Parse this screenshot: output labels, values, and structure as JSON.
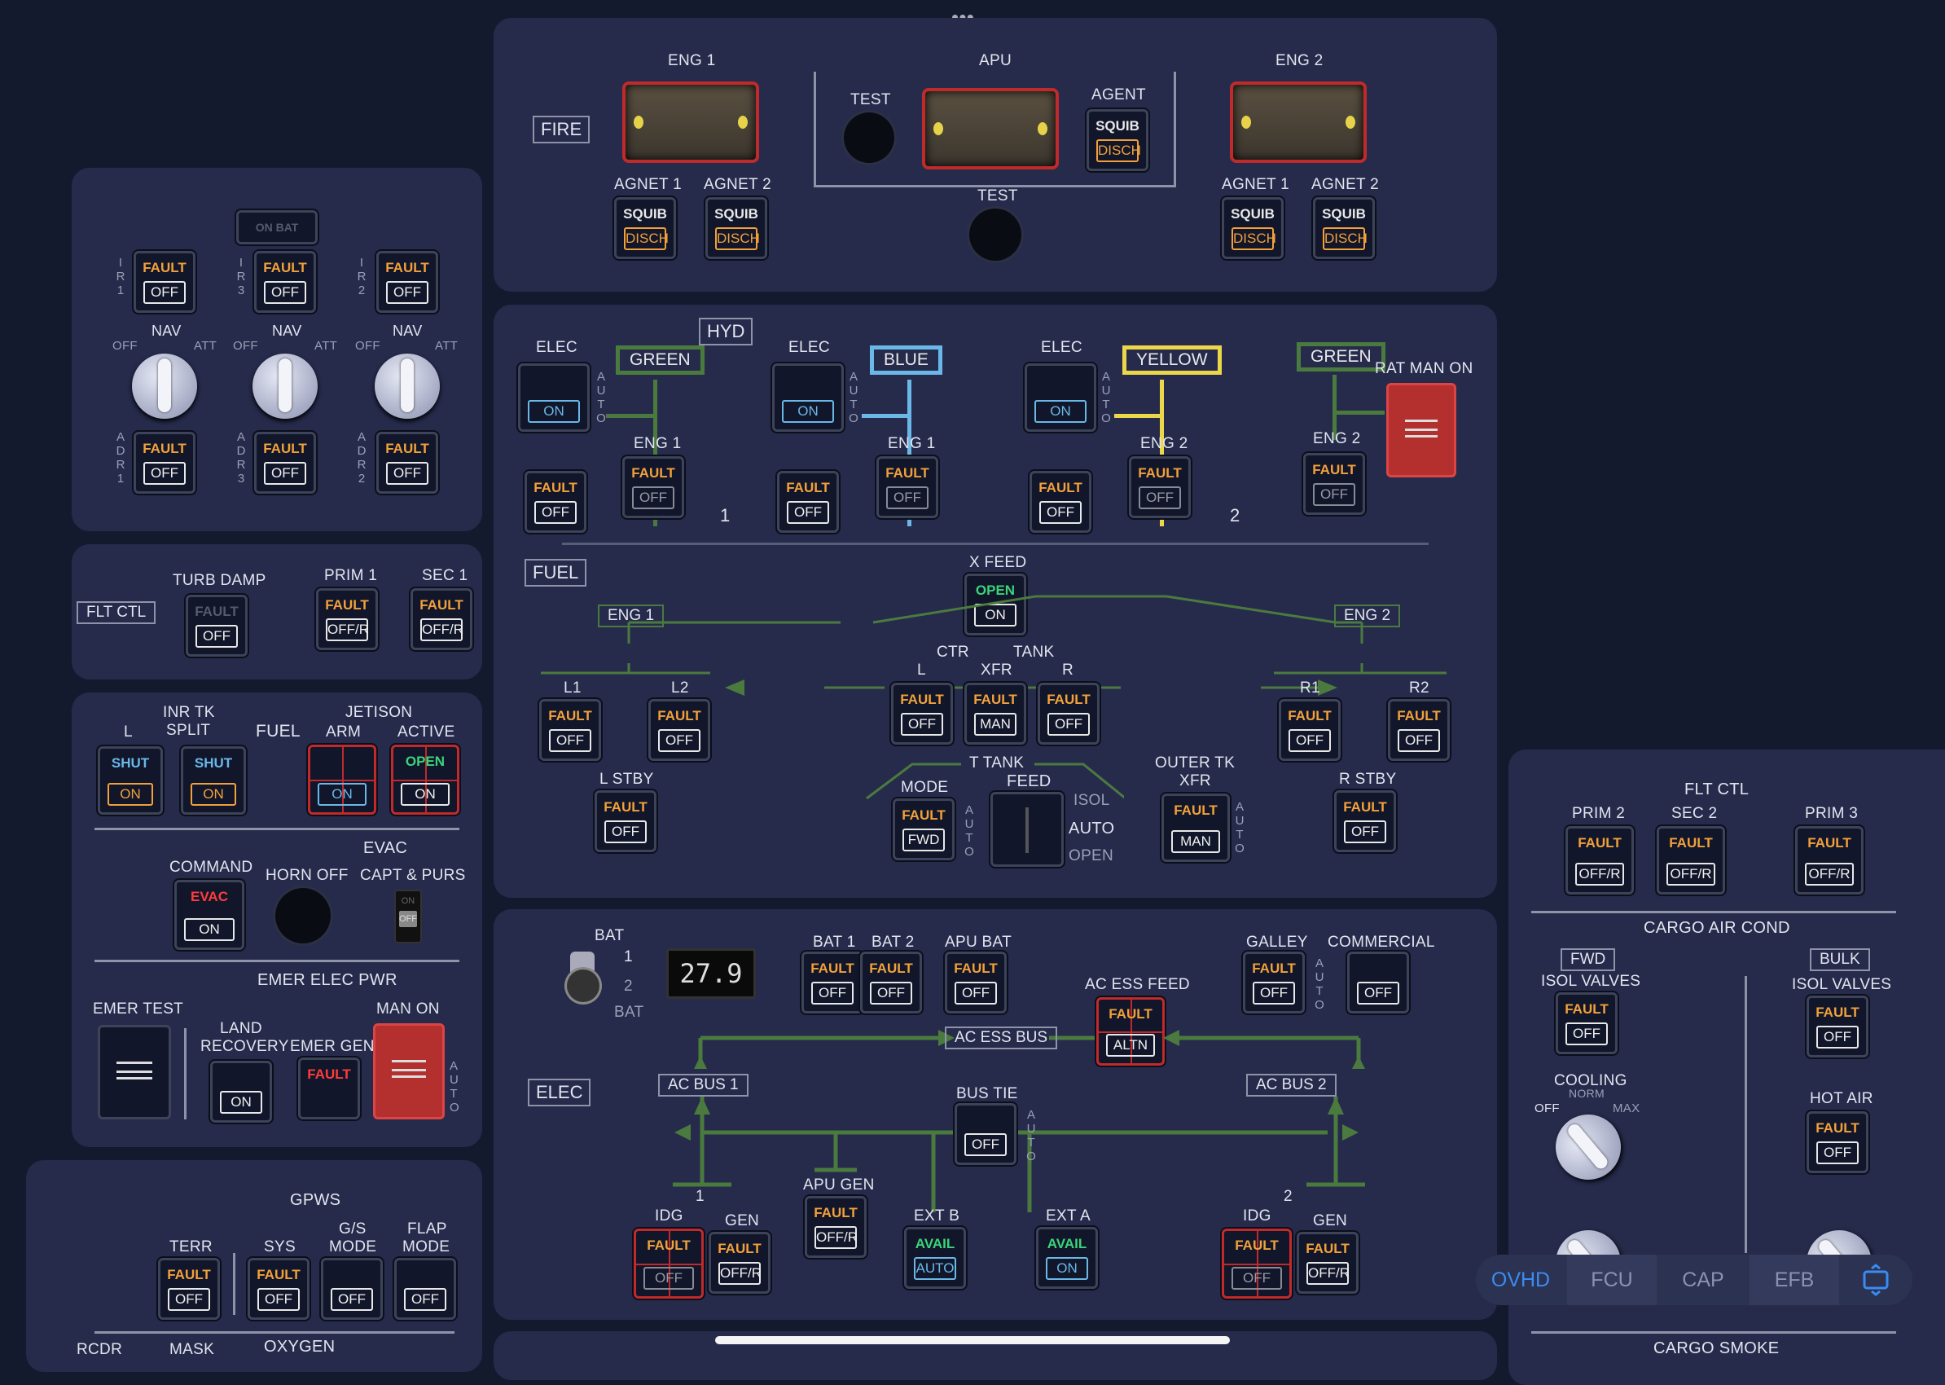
{
  "fire": {
    "title": "FIRE",
    "eng1": "ENG 1",
    "apu": "APU",
    "eng2": "ENG 2",
    "test": "TEST",
    "agent": "AGENT",
    "agnet1": "AGNET 1",
    "agnet2": "AGNET 2",
    "squib": "SQUIB",
    "disch": "DISCH"
  },
  "adirs": {
    "onbat": "ON BAT",
    "fault": "FAULT",
    "off": "OFF",
    "nav": "NAV",
    "offl": "OFF",
    "att": "ATT",
    "ir": [
      "I R 1",
      "I R 3",
      "I R 2"
    ],
    "adr": [
      "A D R 1",
      "A D R 3",
      "A D R 2"
    ]
  },
  "fltctl": {
    "title": "FLT CTL",
    "turb": "TURB DAMP",
    "prim1": "PRIM 1",
    "sec1": "SEC 1",
    "fault": "FAULT",
    "off": "OFF",
    "offr": "OFF/R"
  },
  "fuelleft": {
    "inrtk": "INR TK",
    "split": "SPLIT",
    "l": "L",
    "fuel": "FUEL",
    "jet": "JETISON",
    "arm": "ARM",
    "active": "ACTIVE",
    "shut": "SHUT",
    "on": "ON",
    "open": "OPEN"
  },
  "evac": {
    "evac": "EVAC",
    "command": "COMMAND",
    "horn": "HORN OFF",
    "capt": "CAPT & PURS",
    "evacbtn": "EVAC",
    "on": "ON",
    "onsw": "ON",
    "offsw": "OFF"
  },
  "emer": {
    "title": "EMER ELEC PWR",
    "test": "EMER TEST",
    "land": "LAND",
    "recovery": "RECOVERY",
    "gen": "EMER GEN",
    "manon": "MAN ON",
    "on": "ON",
    "fault": "FAULT",
    "auto": "A U T O"
  },
  "gpws": {
    "title": "GPWS",
    "terr": "TERR",
    "sys": "SYS",
    "gs": "G/S",
    "gsmode": "MODE",
    "flap": "FLAP",
    "flapmode": "MODE",
    "fault": "FAULT",
    "off": "OFF",
    "rcdr": "RCDR",
    "mask": "MASK",
    "oxygen": "OXYGEN"
  },
  "hyd": {
    "title": "HYD",
    "elec": "ELEC",
    "green": "GREEN",
    "blue": "BLUE",
    "yellow": "YELLOW",
    "ratman": "RAT MAN ON",
    "eng1": "ENG 1",
    "eng2": "ENG 2",
    "on": "ON",
    "fault": "FAULT",
    "off": "OFF",
    "n1": "1",
    "n2": "2",
    "auto": "A U T O"
  },
  "fuel": {
    "title": "FUEL",
    "xfeed": "X FEED",
    "open": "OPEN",
    "on": "ON",
    "eng1": "ENG 1",
    "eng2": "ENG 2",
    "ctr": "CTR",
    "tank": "TANK",
    "l": "L",
    "xfr": "XFR",
    "r": "R",
    "l1": "L1",
    "l2": "L2",
    "r1": "R1",
    "r2": "R2",
    "fault": "FAULT",
    "off": "OFF",
    "man": "MAN",
    "lstby": "L STBY",
    "rstby": "R STBY",
    "ttank": "T TANK",
    "mode": "MODE",
    "feed": "FEED",
    "fwd": "FWD",
    "isol": "ISOL",
    "auto": "AUTO",
    "openl": "OPEN",
    "outer": "OUTER TK",
    "xfr2": "XFR",
    "autov": "A U T O"
  },
  "elec": {
    "title": "ELEC",
    "bat": "BAT",
    "b1": "1",
    "b2": "2",
    "batl": "BAT",
    "volt": "27.9",
    "bat1": "BAT 1",
    "bat2": "BAT 2",
    "apubat": "APU BAT",
    "galley": "GALLEY",
    "commercial": "COMMERCIAL",
    "fault": "FAULT",
    "off": "OFF",
    "acessfeed": "AC ESS FEED",
    "altn": "ALTN",
    "acessbus": "AC ESS BUS",
    "acbus1": "AC BUS 1",
    "acbus2": "AC BUS 2",
    "bustie": "BUS TIE",
    "apugen": "APU GEN",
    "offr": "OFF/R",
    "extb": "EXT B",
    "exta": "EXT A",
    "avail": "AVAIL",
    "auto": "AUTO",
    "on": "ON",
    "idg": "IDG",
    "gen": "GEN",
    "n1": "1",
    "n2": "2",
    "autov": "A U T O"
  },
  "right": {
    "fltctl": "FLT CTL",
    "prim2": "PRIM 2",
    "sec2": "SEC 2",
    "prim3": "PRIM 3",
    "fault": "FAULT",
    "offr": "OFF/R",
    "cargo": "CARGO AIR COND",
    "fwd": "FWD",
    "bulk": "BULK",
    "isol": "ISOL VALVES",
    "off": "OFF",
    "cooling": "COOLING",
    "norm": "NORM",
    "offk": "OFF",
    "max": "MAX",
    "hotair": "HOT AIR",
    "smoke": "CARGO SMOKE"
  },
  "tabs": {
    "ovhd": "OVHD",
    "fcu": "FCU",
    "cap": "CAP",
    "efb": "EFB"
  },
  "top_dots": "•••"
}
